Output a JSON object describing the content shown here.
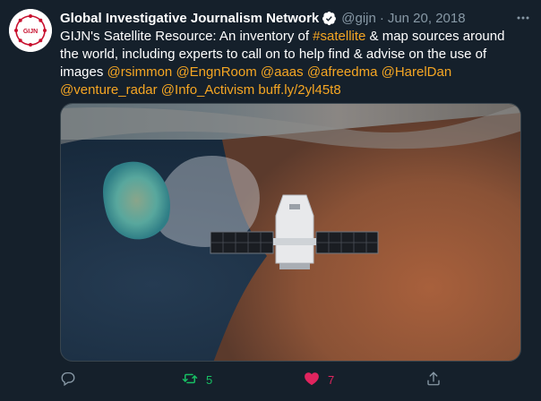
{
  "tweet": {
    "display_name": "Global Investigative Journalism Network",
    "handle": "@gijn",
    "separator": "·",
    "date": "Jun 20, 2018",
    "avatar_text": "GIJN",
    "text_parts": [
      {
        "text": "GIJN's Satellite Resource: An inventory of ",
        "link": false
      },
      {
        "text": "#satellite",
        "link": true
      },
      {
        "text": " & map sources around the world, including experts to call on to help find & advise on the use of images ",
        "link": false
      },
      {
        "text": "@rsimmon",
        "link": true
      },
      {
        "text": " ",
        "link": false
      },
      {
        "text": "@EngnRoom",
        "link": true
      },
      {
        "text": " ",
        "link": false
      },
      {
        "text": "@aaas",
        "link": true
      },
      {
        "text": " ",
        "link": false
      },
      {
        "text": "@afreedma",
        "link": true
      },
      {
        "text": " ",
        "link": false
      },
      {
        "text": "@HarelDan",
        "link": true
      },
      {
        "text": " ",
        "link": false
      },
      {
        "text": "@venture_radar",
        "link": true
      },
      {
        "text": " ",
        "link": false
      },
      {
        "text": "@Info_Activism",
        "link": true
      },
      {
        "text": " ",
        "link": false
      },
      {
        "text": "buff.ly/2yl45t8",
        "link": true
      }
    ],
    "actions": {
      "reply_count": "",
      "retweet_count": "5",
      "like_count": "7"
    }
  },
  "icons": {
    "verified": "verified-badge-icon",
    "more": "more-options-icon",
    "reply": "reply-icon",
    "retweet": "retweet-icon",
    "like": "heart-icon",
    "share": "share-icon"
  },
  "colors": {
    "background": "#15202b",
    "link": "#f5a623",
    "secondary_text": "#8899a6",
    "retweet": "#17bf63",
    "like": "#e0245e"
  }
}
